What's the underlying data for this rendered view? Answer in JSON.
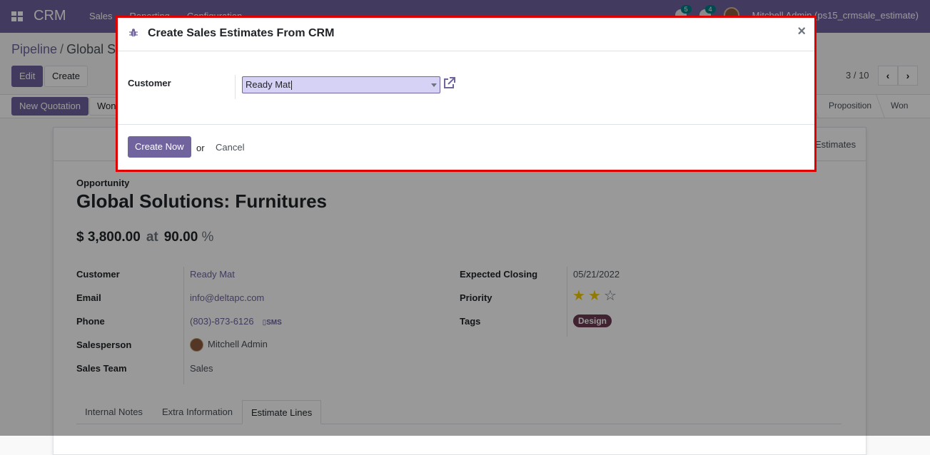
{
  "navbar": {
    "brand": "CRM",
    "menu": [
      "Sales",
      "Reporting",
      "Configuration"
    ],
    "badges": {
      "messages": "5",
      "activities": "4"
    },
    "user": "Mitchell Admin (ps15_crmsale_estimate)"
  },
  "breadcrumb": {
    "parent": "Pipeline",
    "separator": "/",
    "current": "Global Solutions: Furnitures"
  },
  "actions": {
    "edit": "Edit",
    "create": "Create"
  },
  "pager": {
    "value": "3 / 10",
    "prev_icon": "chevron-left-icon",
    "next_icon": "chevron-right-icon"
  },
  "statusbar": {
    "new_quotation": "New Quotation",
    "won": "Won",
    "stages": [
      "Proposition",
      "Won"
    ]
  },
  "form": {
    "smart_button": "Estimates",
    "opportunity_label": "Opportunity",
    "title": "Global Solutions: Furnitures",
    "revenue": "$ 3,800.00",
    "at": "at",
    "probability": "90.00",
    "pct": "%",
    "left_fields": [
      {
        "label": "Customer",
        "value": "Ready Mat"
      },
      {
        "label": "Email",
        "value": "info@deltapc.com"
      },
      {
        "label": "Phone",
        "value": "(803)-873-6126",
        "extra": "SMS"
      },
      {
        "label": "Salesperson",
        "value": "Mitchell Admin"
      },
      {
        "label": "Sales Team",
        "value": "Sales"
      }
    ],
    "right_fields": [
      {
        "label": "Expected Closing",
        "value": "05/21/2022"
      },
      {
        "label": "Priority",
        "stars": 2,
        "max": 3
      },
      {
        "label": "Tags",
        "tag": "Design"
      }
    ],
    "tabs": [
      "Internal Notes",
      "Extra Information",
      "Estimate Lines"
    ],
    "active_tab": "Estimate Lines"
  },
  "modal": {
    "title": "Create Sales Estimates From CRM",
    "close": "×",
    "customer_label": "Customer",
    "customer_value": "Ready Mat",
    "create_button": "Create Now",
    "or": "or",
    "cancel": "Cancel"
  },
  "colors": {
    "brand": "#71639e",
    "highlight_border": "#e00000",
    "tag": "#6c3a52",
    "star": "#f3cc00"
  }
}
